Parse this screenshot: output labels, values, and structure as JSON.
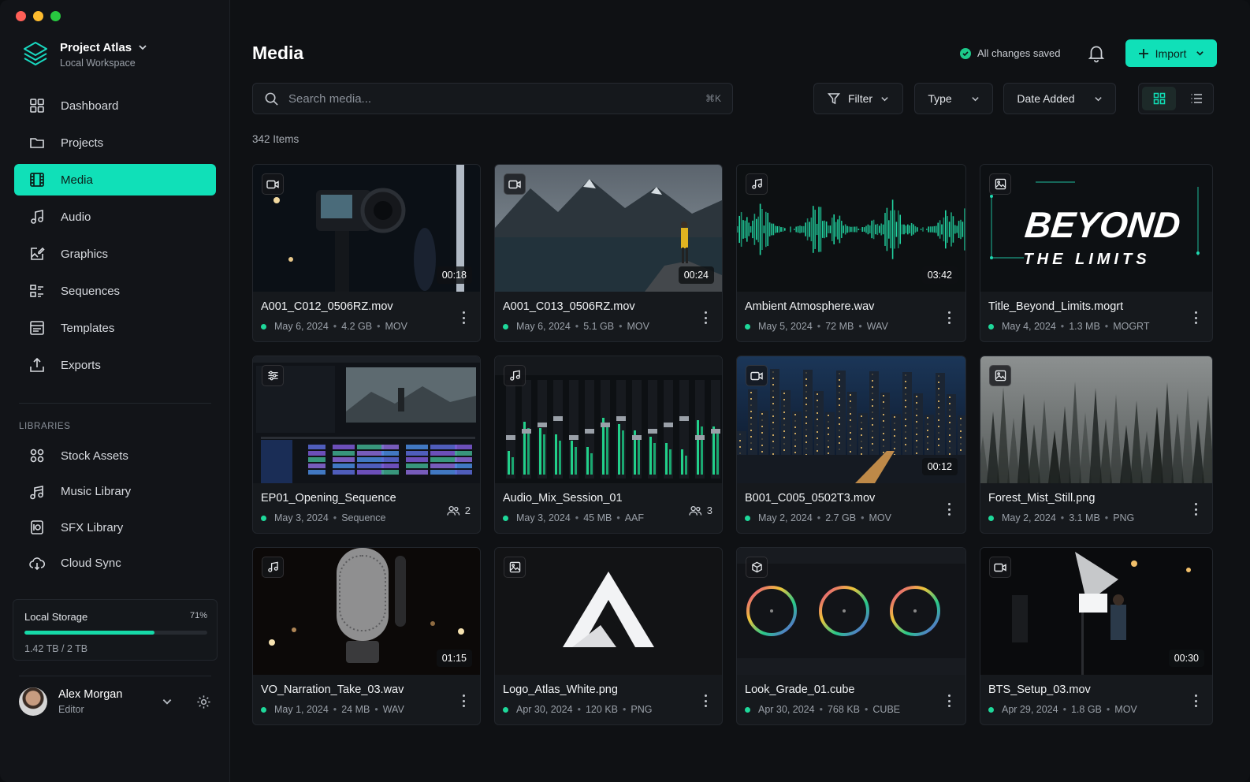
{
  "workspace": {
    "name": "Project Atlas",
    "subtitle": "Local Workspace"
  },
  "nav": [
    {
      "label": "Dashboard",
      "icon": "dashboard-icon"
    },
    {
      "label": "Projects",
      "icon": "folder-icon"
    },
    {
      "label": "Media",
      "icon": "film-icon",
      "active": true
    },
    {
      "label": "Audio",
      "icon": "music-note-icon"
    },
    {
      "label": "Graphics",
      "icon": "edit-image-icon"
    },
    {
      "label": "Sequences",
      "icon": "sequences-icon"
    },
    {
      "label": "Templates",
      "icon": "templates-icon"
    },
    {
      "label": "Exports",
      "icon": "upload-icon"
    }
  ],
  "libraries": {
    "heading": "LIBRARIES",
    "items": [
      {
        "label": "Stock Assets",
        "icon": "stock-assets-icon"
      },
      {
        "label": "Music Library",
        "icon": "music-library-icon"
      },
      {
        "label": "SFX Library",
        "icon": "sfx-icon"
      },
      {
        "label": "Cloud Sync",
        "icon": "cloud-sync-icon"
      }
    ]
  },
  "storage": {
    "label": "Local Storage",
    "percent_label": "71%",
    "fill_fraction": 0.71,
    "used": "1.42 TB / 2 TB"
  },
  "user": {
    "name": "Alex Morgan",
    "role": "Editor"
  },
  "header": {
    "title": "Media",
    "status": "All changes saved",
    "import_label": "Import"
  },
  "search": {
    "placeholder": "Search media...",
    "shortcut": "⌘K"
  },
  "filters": {
    "filter": "Filter",
    "type": "Type",
    "sort": "Date Added"
  },
  "item_count": "342 Items",
  "colors": {
    "accent": "#10e0b8",
    "status_green": "#1ed89a",
    "background": "#0f1114"
  },
  "cards": [
    {
      "name": "A001_C012_0506RZ.mov",
      "date": "May 6, 2024",
      "size": "4.2 GB",
      "kind": "MOV",
      "duration": "00:18",
      "badge": "video-icon",
      "thumb": "camera-set"
    },
    {
      "name": "A001_C013_0506RZ.mov",
      "date": "May 6, 2024",
      "size": "5.1 GB",
      "kind": "MOV",
      "duration": "00:24",
      "badge": "video-icon",
      "thumb": "mountain-lake"
    },
    {
      "name": "Ambient Atmosphere.wav",
      "date": "May 5, 2024",
      "size": "72 MB",
      "kind": "WAV",
      "duration": "03:42",
      "badge": "music-note-icon",
      "thumb": "waveform"
    },
    {
      "name": "Title_Beyond_Limits.mogrt",
      "date": "May 4, 2024",
      "size": "1.3 MB",
      "kind": "MOGRT",
      "badge": "image-icon",
      "thumb": "title",
      "title_line1": "BEYOND",
      "title_line2": "THE LIMITS"
    },
    {
      "name": "EP01_Opening_Sequence",
      "date": "May 3, 2024",
      "kind": "Sequence",
      "collaborators": "2",
      "badge": "sequence-icon",
      "thumb": "editor"
    },
    {
      "name": "Audio_Mix_Session_01",
      "date": "May 3, 2024",
      "size": "45 MB",
      "kind": "AAF",
      "collaborators": "3",
      "badge": "music-note-icon",
      "thumb": "mixer"
    },
    {
      "name": "B001_C005_0502T3.mov",
      "date": "May 2, 2024",
      "size": "2.7 GB",
      "kind": "MOV",
      "duration": "00:12",
      "badge": "video-icon",
      "thumb": "city"
    },
    {
      "name": "Forest_Mist_Still.png",
      "date": "May 2, 2024",
      "size": "3.1 MB",
      "kind": "PNG",
      "badge": "image-icon",
      "thumb": "forest"
    },
    {
      "name": "VO_Narration_Take_03.wav",
      "date": "May 1, 2024",
      "size": "24 MB",
      "kind": "WAV",
      "duration": "01:15",
      "badge": "music-note-icon",
      "thumb": "microphone"
    },
    {
      "name": "Logo_Atlas_White.png",
      "date": "Apr 30, 2024",
      "size": "120 KB",
      "kind": "PNG",
      "badge": "image-icon",
      "thumb": "logo"
    },
    {
      "name": "Look_Grade_01.cube",
      "date": "Apr 30, 2024",
      "size": "768 KB",
      "kind": "CUBE",
      "badge": "cube-icon",
      "thumb": "color-wheels"
    },
    {
      "name": "BTS_Setup_03.mov",
      "date": "Apr 29, 2024",
      "size": "1.8 GB",
      "kind": "MOV",
      "duration": "00:30",
      "badge": "video-icon",
      "thumb": "studio"
    }
  ]
}
